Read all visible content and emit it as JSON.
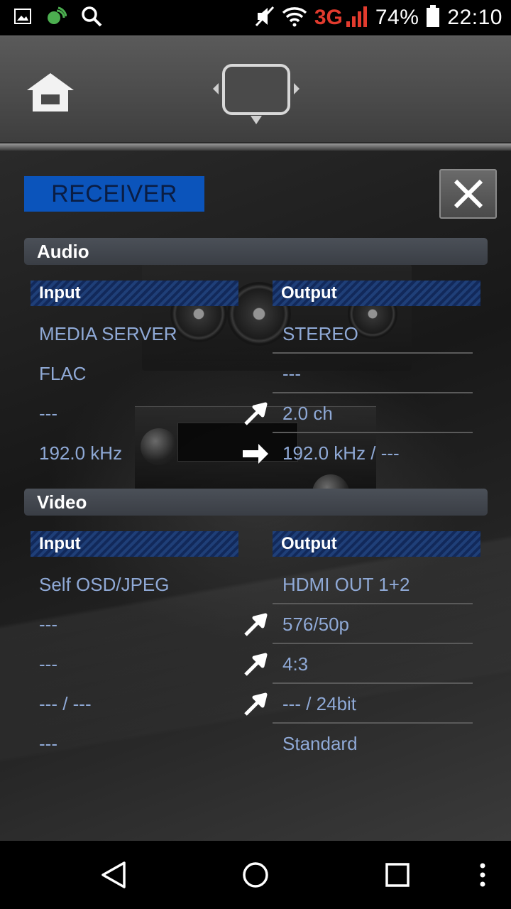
{
  "status_bar": {
    "battery": "74%",
    "time": "22:10",
    "network": "3G",
    "icons": [
      "image-icon",
      "sync-icon",
      "search-icon",
      "mute-icon",
      "wifi-icon",
      "signal-icon",
      "battery-icon"
    ]
  },
  "toolbar": {
    "home_icon": "home-icon",
    "screen_icon": "screen-icon"
  },
  "panel": {
    "title": "RECEIVER",
    "close_icon": "close-icon"
  },
  "audio": {
    "header": "Audio",
    "input_label": "Input",
    "output_label": "Output",
    "rows": [
      {
        "input": "MEDIA SERVER",
        "output": "STEREO",
        "arrow": "none"
      },
      {
        "input": "FLAC",
        "output": "---",
        "arrow": "none"
      },
      {
        "input": "---",
        "output": "2.0 ch",
        "arrow": "diagonal"
      },
      {
        "input": "192.0 kHz",
        "output": "192.0 kHz / ---",
        "arrow": "right"
      }
    ]
  },
  "video": {
    "header": "Video",
    "input_label": "Input",
    "output_label": "Output",
    "rows": [
      {
        "input": "Self OSD/JPEG",
        "output": "HDMI OUT 1+2",
        "arrow": "none"
      },
      {
        "input": "---",
        "output": "576/50p",
        "arrow": "diagonal"
      },
      {
        "input": "---",
        "output": "4:3",
        "arrow": "diagonal"
      },
      {
        "input": "--- / ---",
        "output": "--- / 24bit",
        "arrow": "diagonal"
      },
      {
        "input": "---",
        "output": "Standard",
        "arrow": "none"
      }
    ]
  },
  "nav_bar": {
    "icons": [
      "back-icon",
      "home-circle-icon",
      "recents-icon",
      "more-icon"
    ]
  },
  "colors": {
    "accent_blue": "#0b54bb",
    "value_text": "#8fa9d6",
    "signal_red": "#e23b2e"
  }
}
